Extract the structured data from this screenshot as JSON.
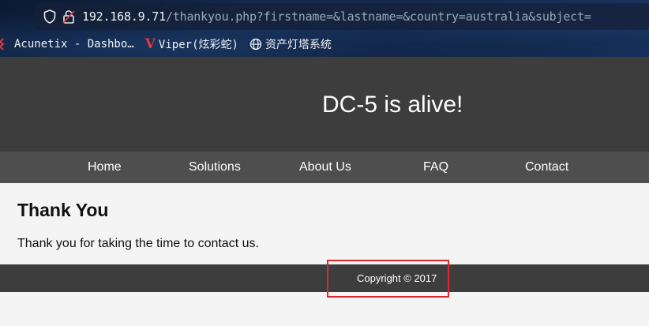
{
  "browser": {
    "url_host": "192.168.9.71",
    "url_path": "/thankyou.php?firstname=&lastname=&country=australia&subject=",
    "bookmarks": [
      {
        "label": "Acunetix - Dashbo…",
        "icon": "acunetix-icon"
      },
      {
        "label": "Viper(炫彩蛇)",
        "icon": "viper-icon",
        "icon_glyph": "V"
      },
      {
        "label": "资产灯塔系统",
        "icon": "globe-icon"
      }
    ]
  },
  "site": {
    "title": "DC-5 is alive!",
    "nav": [
      "Home",
      "Solutions",
      "About Us",
      "FAQ",
      "Contact"
    ]
  },
  "content": {
    "heading": "Thank You",
    "message": "Thank you for taking the time to contact us."
  },
  "footer": {
    "copyright": "Copyright © 2017"
  },
  "colors": {
    "header_bg": "#3d3d3d",
    "nav_bg": "#4e4e4e",
    "highlight": "#e0262d"
  }
}
